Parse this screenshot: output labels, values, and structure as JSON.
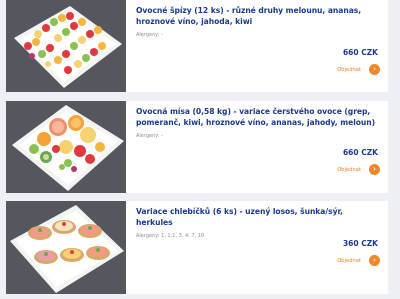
{
  "products": [
    {
      "title": "Ovocné špízy (12 ks) - různé druhy melounu, ananas, hroznové víno, jahoda, kiwi",
      "allergens": "Alergeny: -",
      "price": "660 CZK",
      "order_label": "Objednat",
      "image": "fruit-skewers-platter"
    },
    {
      "title": "Ovocná mísa (0,58 kg) - variace čerstvého ovoce (grep, pomeranč, kiwi, hroznové víno, ananas, jahody, meloun)",
      "allergens": "Alergeny: -",
      "price": "660 CZK",
      "order_label": "Objednat",
      "image": "fruit-bowl-platter"
    },
    {
      "title": "Variace chlebíčků (6 ks) - uzený losos, šunka/sýr, herkules",
      "allergens": "Alergeny: 1, 1.1, 3, 4, 7, 10",
      "price": "360 CZK",
      "order_label": "Objednat",
      "image": "open-sandwiches-platter"
    }
  ],
  "icons": {
    "order": "chevron-right-icon"
  },
  "colors": {
    "accent": "#f0872a",
    "title": "#1b3a8c",
    "background": "#eef0f6",
    "thumb_bg": "#54575e"
  }
}
